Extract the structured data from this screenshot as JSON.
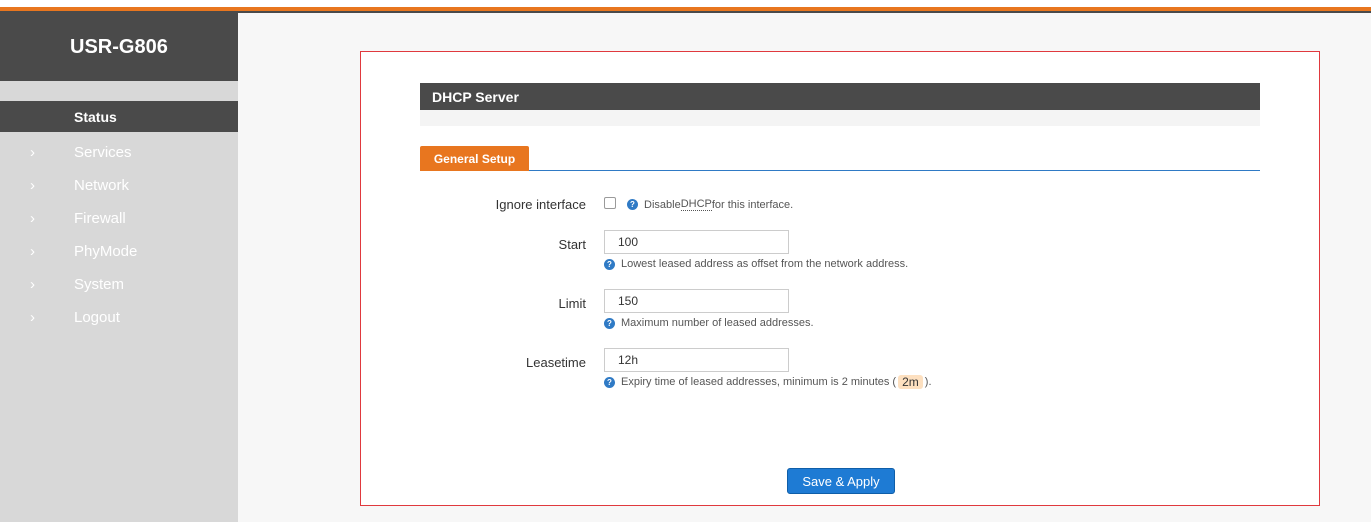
{
  "app": {
    "brand": "USR-G806"
  },
  "sidebar": {
    "items": [
      {
        "label": "Status",
        "active": true
      },
      {
        "label": "Services"
      },
      {
        "label": "Network"
      },
      {
        "label": "Firewall"
      },
      {
        "label": "PhyMode"
      },
      {
        "label": "System"
      },
      {
        "label": "Logout"
      }
    ]
  },
  "main": {
    "section_title": "DHCP Server",
    "tab_label": "General Setup",
    "ignore_interface": {
      "label": "Ignore interface",
      "checked": false,
      "hint_pre": "Disable ",
      "hint_abbr": "DHCP",
      "hint_post": " for this interface."
    },
    "start": {
      "label": "Start",
      "value": "100",
      "hint": "Lowest leased address as offset from the network address."
    },
    "limit": {
      "label": "Limit",
      "value": "150",
      "hint": "Maximum number of leased addresses."
    },
    "leasetime": {
      "label": "Leasetime",
      "value": "12h",
      "hint_pre": "Expiry time of leased addresses, minimum is 2 minutes (",
      "hint_code": "2m",
      "hint_post": ")."
    },
    "save_label": "Save & Apply"
  },
  "colors": {
    "accent": "#e8761f",
    "dark": "#4a4a4a",
    "primary": "#1e7bd4",
    "frame": "#e0393e"
  },
  "icons": {
    "menu_chevron": "chevron-right-icon",
    "help": "help-icon"
  }
}
